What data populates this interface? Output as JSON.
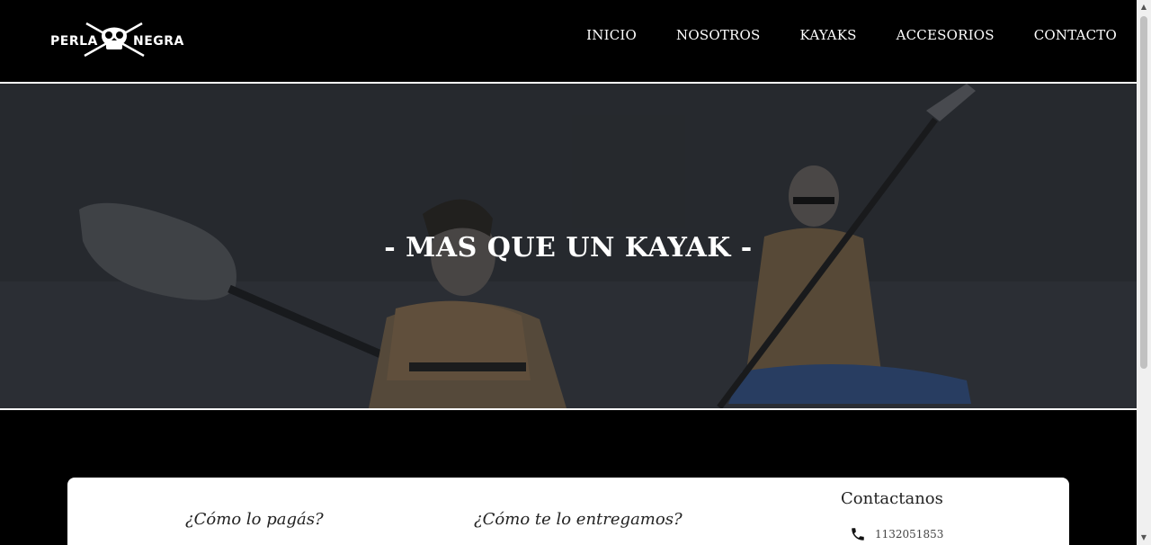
{
  "brand": {
    "left": "PERLA",
    "right": "NEGRA"
  },
  "nav": [
    {
      "label": "INICIO"
    },
    {
      "label": "NOSOTROS"
    },
    {
      "label": "KAYAKS"
    },
    {
      "label": "ACCESORIOS"
    },
    {
      "label": "CONTACTO"
    }
  ],
  "hero": {
    "title": "- MAS QUE UN KAYAK -"
  },
  "info": {
    "pay_heading": "¿Cómo lo pagás?",
    "ship_heading": "¿Cómo te lo entregamos?",
    "contact_heading": "Contactanos",
    "phone": "1132051853"
  },
  "colors": {
    "background": "#000000",
    "card": "#ffffff",
    "text_light": "#ffffff",
    "text_dark": "#222222"
  },
  "icons": {
    "logo": "pirate-skull-icon",
    "phone": "phone-icon"
  }
}
